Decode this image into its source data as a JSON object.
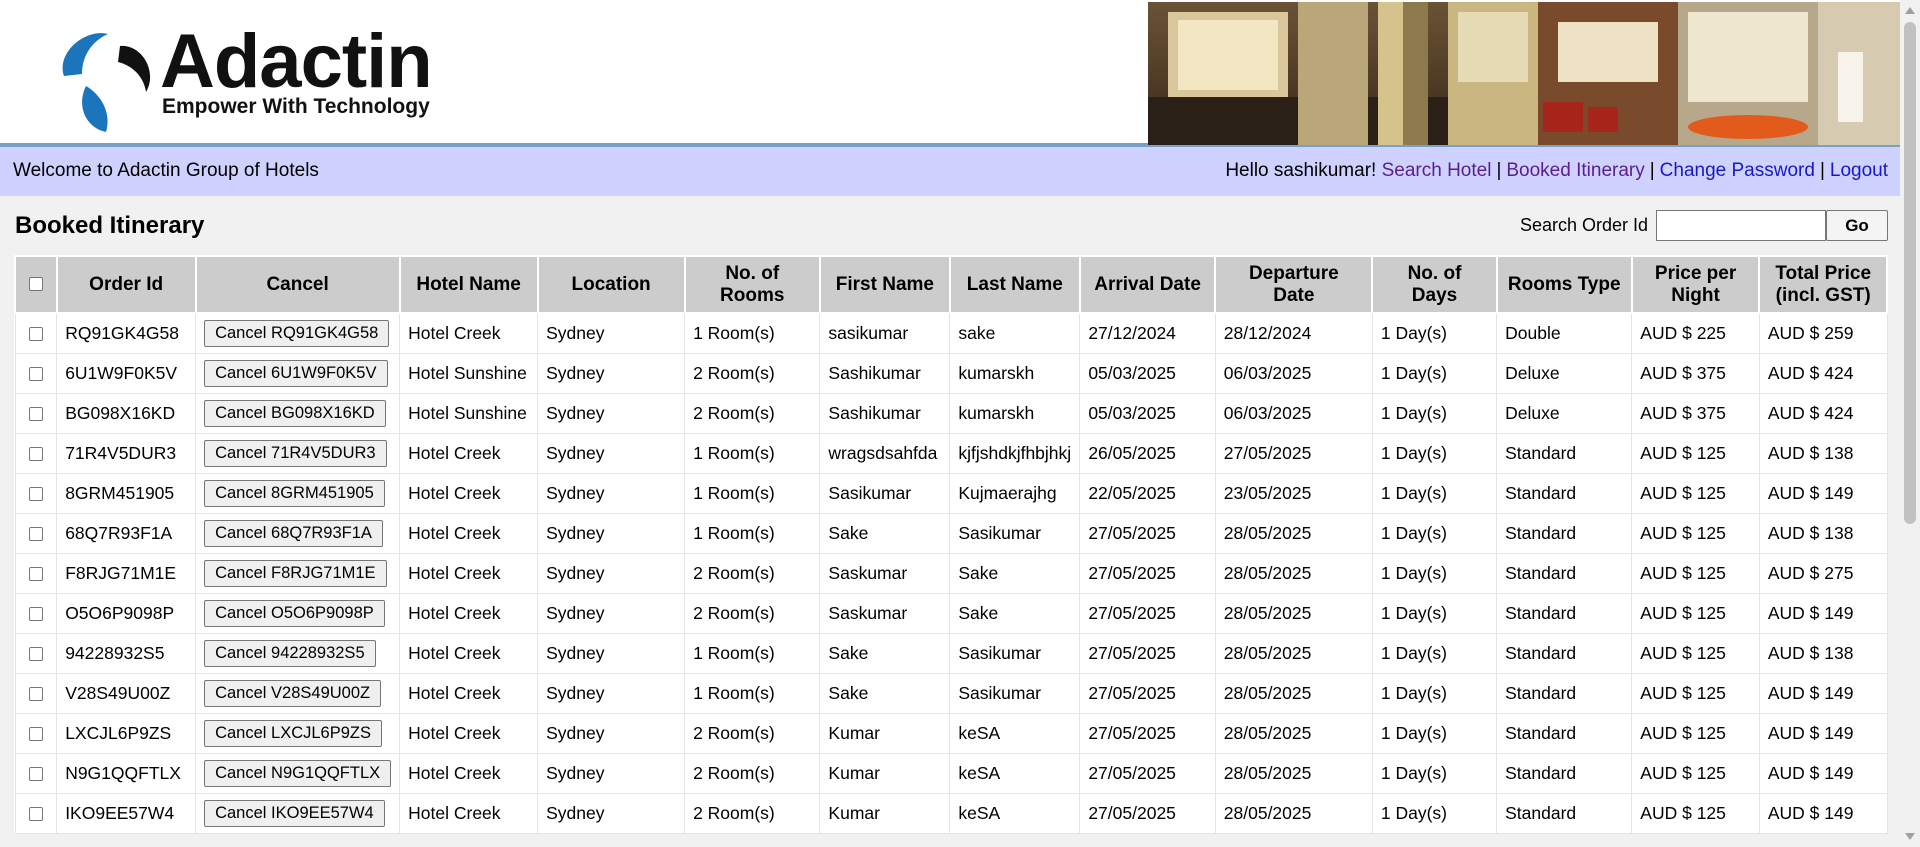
{
  "brand": {
    "name": "Adactin",
    "tagline": "Empower With Technology",
    "colors": {
      "blue": "#1b75bc",
      "accent_bar": "#cfd2ff",
      "header_border": "#7a9fc9"
    }
  },
  "welcome_bar": {
    "welcome": "Welcome to Adactin Group of Hotels",
    "greeting": "Hello sashikumar!",
    "links": {
      "search_hotel": "Search Hotel",
      "booked_itinerary": "Booked Itinerary",
      "change_password": "Change Password",
      "logout": "Logout"
    },
    "separator": "|"
  },
  "main": {
    "title": "Booked Itinerary",
    "search": {
      "label": "Search Order Id",
      "value": "",
      "go_label": "Go"
    }
  },
  "table": {
    "headers": {
      "order_id": "Order Id",
      "cancel": "Cancel",
      "hotel_name": "Hotel Name",
      "location": "Location",
      "rooms_1": "No. of",
      "rooms_2": "Rooms",
      "first_name": "First Name",
      "last_name": "Last Name",
      "arrival": "Arrival Date",
      "departure_1": "Departure",
      "departure_2": "Date",
      "days_1": "No. of",
      "days_2": "Days",
      "rooms_type": "Rooms Type",
      "price_1": "Price per",
      "price_2": "Night",
      "total_1": "Total Price",
      "total_2": "(incl. GST)"
    },
    "rows": [
      {
        "order_id": "RQ91GK4G58",
        "cancel": "Cancel RQ91GK4G58",
        "hotel": "Hotel Creek",
        "location": "Sydney",
        "rooms": "1 Room(s)",
        "first": "sasikumar",
        "last": "sake",
        "arrival": "27/12/2024",
        "departure": "28/12/2024",
        "days": "1 Day(s)",
        "type": "Double",
        "price": "AUD $ 225",
        "total": "AUD $ 259"
      },
      {
        "order_id": "6U1W9F0K5V",
        "cancel": "Cancel 6U1W9F0K5V",
        "hotel": "Hotel Sunshine",
        "location": "Sydney",
        "rooms": "2 Room(s)",
        "first": "Sashikumar",
        "last": "kumarskh",
        "arrival": "05/03/2025",
        "departure": "06/03/2025",
        "days": "1 Day(s)",
        "type": "Deluxe",
        "price": "AUD $ 375",
        "total": "AUD $ 424"
      },
      {
        "order_id": "BG098X16KD",
        "cancel": "Cancel BG098X16KD",
        "hotel": "Hotel Sunshine",
        "location": "Sydney",
        "rooms": "2 Room(s)",
        "first": "Sashikumar",
        "last": "kumarskh",
        "arrival": "05/03/2025",
        "departure": "06/03/2025",
        "days": "1 Day(s)",
        "type": "Deluxe",
        "price": "AUD $ 375",
        "total": "AUD $ 424"
      },
      {
        "order_id": "71R4V5DUR3",
        "cancel": "Cancel 71R4V5DUR3",
        "hotel": "Hotel Creek",
        "location": "Sydney",
        "rooms": "1 Room(s)",
        "first": "wragsdsahfda",
        "last": "kjfjshdkjfhbjhkj",
        "arrival": "26/05/2025",
        "departure": "27/05/2025",
        "days": "1 Day(s)",
        "type": "Standard",
        "price": "AUD $ 125",
        "total": "AUD $ 138"
      },
      {
        "order_id": "8GRM451905",
        "cancel": "Cancel 8GRM451905",
        "hotel": "Hotel Creek",
        "location": "Sydney",
        "rooms": "1 Room(s)",
        "first": "Sasikumar",
        "last": "Kujmaerajhg",
        "arrival": "22/05/2025",
        "departure": "23/05/2025",
        "days": "1 Day(s)",
        "type": "Standard",
        "price": "AUD $ 125",
        "total": "AUD $ 149"
      },
      {
        "order_id": "68Q7R93F1A",
        "cancel": "Cancel 68Q7R93F1A",
        "hotel": "Hotel Creek",
        "location": "Sydney",
        "rooms": "1 Room(s)",
        "first": "Sake",
        "last": "Sasikumar",
        "arrival": "27/05/2025",
        "departure": "28/05/2025",
        "days": "1 Day(s)",
        "type": "Standard",
        "price": "AUD $ 125",
        "total": "AUD $ 138"
      },
      {
        "order_id": "F8RJG71M1E",
        "cancel": "Cancel F8RJG71M1E",
        "hotel": "Hotel Creek",
        "location": "Sydney",
        "rooms": "2 Room(s)",
        "first": "Saskumar",
        "last": "Sake",
        "arrival": "27/05/2025",
        "departure": "28/05/2025",
        "days": "1 Day(s)",
        "type": "Standard",
        "price": "AUD $ 125",
        "total": "AUD $ 275"
      },
      {
        "order_id": "O5O6P9098P",
        "cancel": "Cancel O5O6P9098P",
        "hotel": "Hotel Creek",
        "location": "Sydney",
        "rooms": "2 Room(s)",
        "first": "Saskumar",
        "last": "Sake",
        "arrival": "27/05/2025",
        "departure": "28/05/2025",
        "days": "1 Day(s)",
        "type": "Standard",
        "price": "AUD $ 125",
        "total": "AUD $ 149"
      },
      {
        "order_id": "94228932S5",
        "cancel": "Cancel 94228932S5",
        "hotel": "Hotel Creek",
        "location": "Sydney",
        "rooms": "1 Room(s)",
        "first": "Sake",
        "last": "Sasikumar",
        "arrival": "27/05/2025",
        "departure": "28/05/2025",
        "days": "1 Day(s)",
        "type": "Standard",
        "price": "AUD $ 125",
        "total": "AUD $ 138"
      },
      {
        "order_id": "V28S49U00Z",
        "cancel": "Cancel V28S49U00Z",
        "hotel": "Hotel Creek",
        "location": "Sydney",
        "rooms": "1 Room(s)",
        "first": "Sake",
        "last": "Sasikumar",
        "arrival": "27/05/2025",
        "departure": "28/05/2025",
        "days": "1 Day(s)",
        "type": "Standard",
        "price": "AUD $ 125",
        "total": "AUD $ 149"
      },
      {
        "order_id": "LXCJL6P9ZS",
        "cancel": "Cancel LXCJL6P9ZS",
        "hotel": "Hotel Creek",
        "location": "Sydney",
        "rooms": "2 Room(s)",
        "first": "Kumar",
        "last": "keSA",
        "arrival": "27/05/2025",
        "departure": "28/05/2025",
        "days": "1 Day(s)",
        "type": "Standard",
        "price": "AUD $ 125",
        "total": "AUD $ 149"
      },
      {
        "order_id": "N9G1QQFTLX",
        "cancel": "Cancel N9G1QQFTLX",
        "hotel": "Hotel Creek",
        "location": "Sydney",
        "rooms": "2 Room(s)",
        "first": "Kumar",
        "last": "keSA",
        "arrival": "27/05/2025",
        "departure": "28/05/2025",
        "days": "1 Day(s)",
        "type": "Standard",
        "price": "AUD $ 125",
        "total": "AUD $ 149"
      },
      {
        "order_id": "IKO9EE57W4",
        "cancel": "Cancel IKO9EE57W4",
        "hotel": "Hotel Creek",
        "location": "Sydney",
        "rooms": "2 Room(s)",
        "first": "Kumar",
        "last": "keSA",
        "arrival": "27/05/2025",
        "departure": "28/05/2025",
        "days": "1 Day(s)",
        "type": "Standard",
        "price": "AUD $ 125",
        "total": "AUD $ 149"
      }
    ]
  }
}
